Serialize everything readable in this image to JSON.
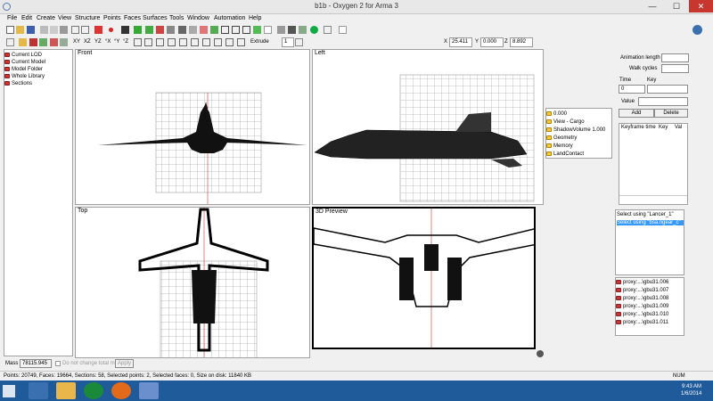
{
  "window": {
    "title": "b1b - Oxygen 2 for Arma 3",
    "minimize": "—",
    "maximize": "☐",
    "close": "✕"
  },
  "menu": [
    "File",
    "Edit",
    "Create",
    "View",
    "Structure",
    "Points",
    "Faces",
    "Surfaces",
    "Tools",
    "Window",
    "Automation",
    "Help"
  ],
  "toolbar2": {
    "axes": [
      "XY",
      "XZ",
      "YZ",
      "°X",
      "°Y",
      "°Z"
    ],
    "extrude_label": "Extrude",
    "extrude_value": "1",
    "x_label": "X",
    "x_value": "25.411",
    "y_label": "Y",
    "y_value": "0.000",
    "z_label": "Z",
    "z_value": "8.892"
  },
  "lod_tree": [
    "Current LOD",
    "Current Model",
    "Model Folder",
    "Whole Library",
    "Sections"
  ],
  "viewports": {
    "front": "Front",
    "left": "Left",
    "top": "Top",
    "preview": "3D Preview"
  },
  "lods": [
    "0.000",
    "View - Cargo",
    "ShadowVolume 1.000",
    "Geometry",
    "Memory",
    "LandContact"
  ],
  "animation": {
    "length_label": "Animation length",
    "walk_label": "Walk cycles",
    "time_label": "Time",
    "time_value": "0",
    "key_label": "Key",
    "value_label": "Value",
    "add": "Add",
    "delete": "Delete",
    "columns": [
      "Keyframe time",
      "Key",
      "Val"
    ]
  },
  "selections": [
    "Select using \"Lancer_1\"",
    "Select using \"bsa.ngear_c\""
  ],
  "proxies": [
    "proxy:...\\gbu31.006",
    "proxy:...\\gbu31.007",
    "proxy:...\\gbu31.008",
    "proxy:...\\gbu31.009",
    "proxy:...\\gbu31.010",
    "proxy:...\\gbu31.011"
  ],
  "mass": {
    "label": "Mass",
    "value": "78115.945",
    "checkbox": "Do not change total mass",
    "apply": "Apply"
  },
  "status": {
    "text": "Points: 20749, Faces: 19664, Sections: 58, Selected points: 2, Selected faces: 0, Size on disk: 11840 KB",
    "num": "NUM"
  },
  "clock": {
    "time": "9:43 AM",
    "date": "1/6/2014"
  },
  "colors": {
    "taskbar": "#1f5a9a",
    "selection": "#3399ff",
    "close": "#c7372f"
  }
}
